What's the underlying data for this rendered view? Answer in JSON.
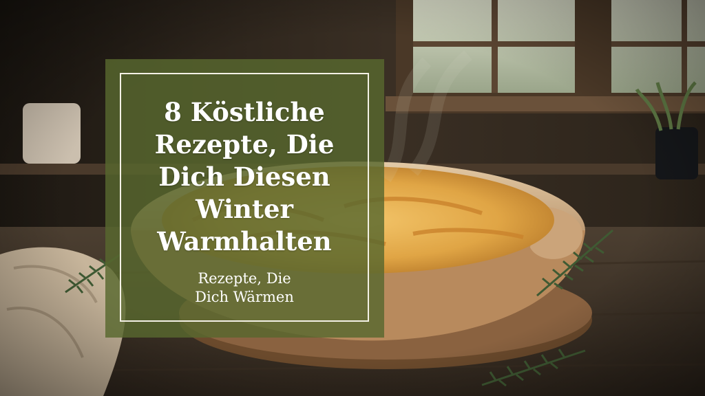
{
  "overlay": {
    "headline_lines": [
      "8 Köstliche",
      "Rezepte, Die",
      "Dich Diesen",
      "Winter",
      "Warmhalten"
    ],
    "subline_lines": [
      "Rezepte, Die",
      "Dich Wärmen"
    ]
  },
  "colors": {
    "overlay_green": "#58682e",
    "frame": "#f4f1e6",
    "text": "#ffffff"
  }
}
